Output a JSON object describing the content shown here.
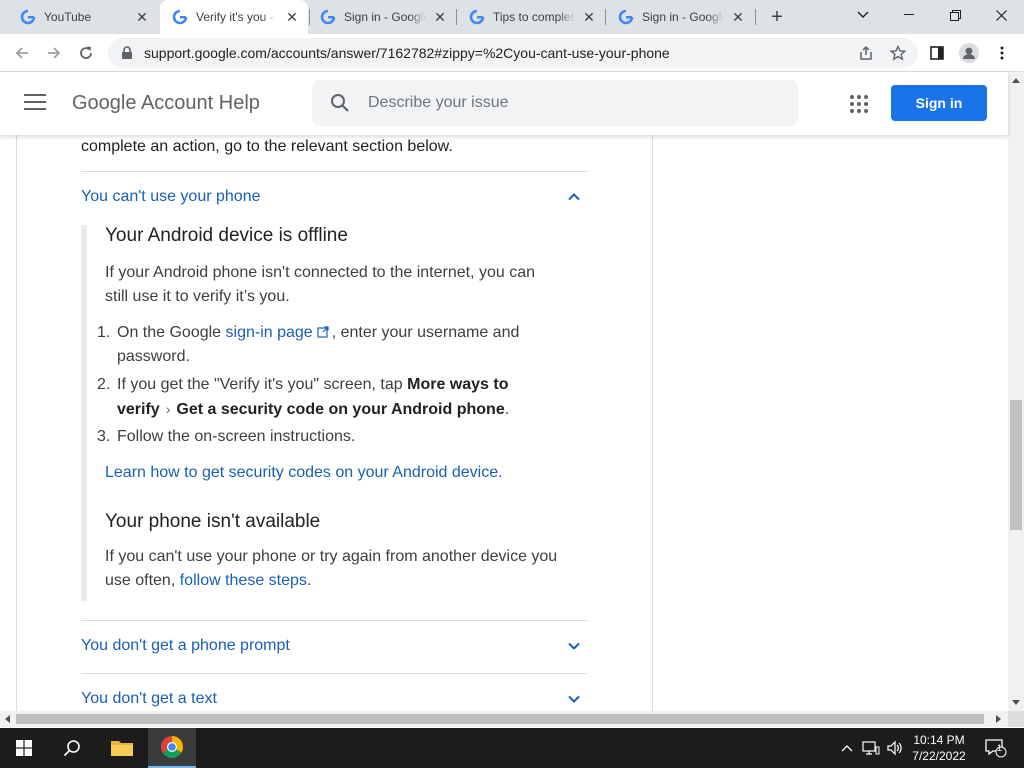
{
  "browser": {
    "tabs": [
      {
        "title": "YouTube",
        "active": false
      },
      {
        "title": "Verify it's you -",
        "active": true
      },
      {
        "title": "Sign in - Google",
        "active": false
      },
      {
        "title": "Tips to complete",
        "active": false
      },
      {
        "title": "Sign in - Google",
        "active": false
      }
    ],
    "url": "support.google.com/accounts/answer/7162782#zippy=%2Cyou-cant-use-your-phone"
  },
  "header": {
    "title": "Google Account Help",
    "search_placeholder": "Describe your issue",
    "signin_label": "Sign in"
  },
  "article": {
    "intro_tail": "complete an action, go to the relevant section below.",
    "accordion_open": {
      "title": "You can't use your phone",
      "section1": {
        "heading": "Your Android device is offline",
        "para_line1": "If your Android phone isn't connected to the internet, you can",
        "para_line2": "still use it to verify it’s you.",
        "steps": {
          "s1_pre": "On the Google",
          "s1_link": "sign-in page",
          "s1_post": ", enter your username and",
          "s1_line2": "password.",
          "s2_pre": "If you get the \"Verify it's you\" screen, tap",
          "s2_bold1": "More ways to",
          "s2_bold2": "verify",
          "s2_bold3": "Get a security code on your Android phone",
          "s2_end": ".",
          "s3": "Follow the on-screen instructions."
        },
        "learn_link": "Learn how to get security codes on your Android device",
        "learn_end": "."
      },
      "section2": {
        "heading": "Your phone isn't available",
        "para_line1": "If you can't use your phone or try again from another device you",
        "para_pre": "use often,",
        "para_link": "follow these steps",
        "para_end": "."
      }
    },
    "accordion_closed": [
      {
        "title": "You don't get a phone prompt"
      },
      {
        "title": "You don't get a text"
      }
    ]
  },
  "taskbar": {
    "time": "10:14 PM",
    "date": "7/22/2022",
    "notification_count": "1"
  },
  "colors": {
    "accent": "#1a73e8",
    "link": "#1a5fb4",
    "tab_strip": "#dee1e6",
    "taskbar": "#1c1c1c"
  }
}
